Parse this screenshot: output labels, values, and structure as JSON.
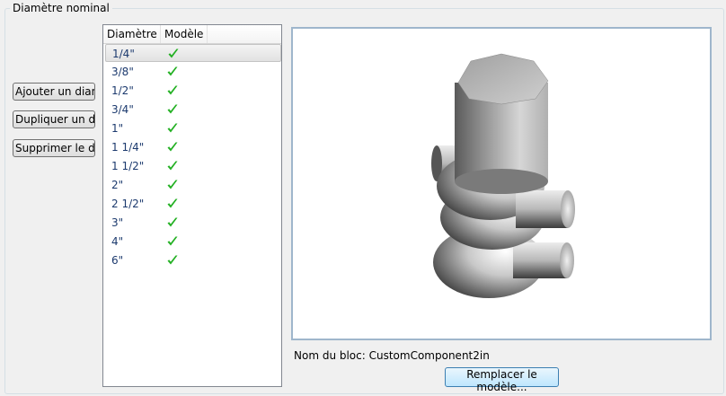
{
  "group": {
    "title": "Diamètre nominal"
  },
  "buttons": {
    "add": "Ajouter un diamètre",
    "duplicate": "Dupliquer un diamètre",
    "delete": "Supprimer le diamètre"
  },
  "list": {
    "columns": [
      "Diamètre nominal",
      "Modèle"
    ],
    "rows": [
      {
        "size": "1/4\"",
        "model": "check-icon"
      },
      {
        "size": "3/8\"",
        "model": "check-icon"
      },
      {
        "size": "1/2\"",
        "model": "check-icon"
      },
      {
        "size": "3/4\"",
        "model": "check-icon"
      },
      {
        "size": "1\"",
        "model": "check-icon"
      },
      {
        "size": "1 1/4\"",
        "model": "check-icon"
      },
      {
        "size": "1 1/2\"",
        "model": "check-icon"
      },
      {
        "size": "2\"",
        "model": "check-icon"
      },
      {
        "size": "2 1/2\"",
        "model": "check-icon"
      },
      {
        "size": "3\"",
        "model": "check-icon"
      },
      {
        "size": "4\"",
        "model": "check-icon"
      },
      {
        "size": "6\"",
        "model": "check-icon"
      }
    ],
    "selected_index": 0
  },
  "preview": {
    "block_name_label": "Nom du bloc: CustomComponent2in",
    "replace_button": "Remplacer le modèle..."
  },
  "colors": {
    "check": "#22b022",
    "row_text": "#1c3a6e",
    "preview_border": "#9fb6cc"
  }
}
